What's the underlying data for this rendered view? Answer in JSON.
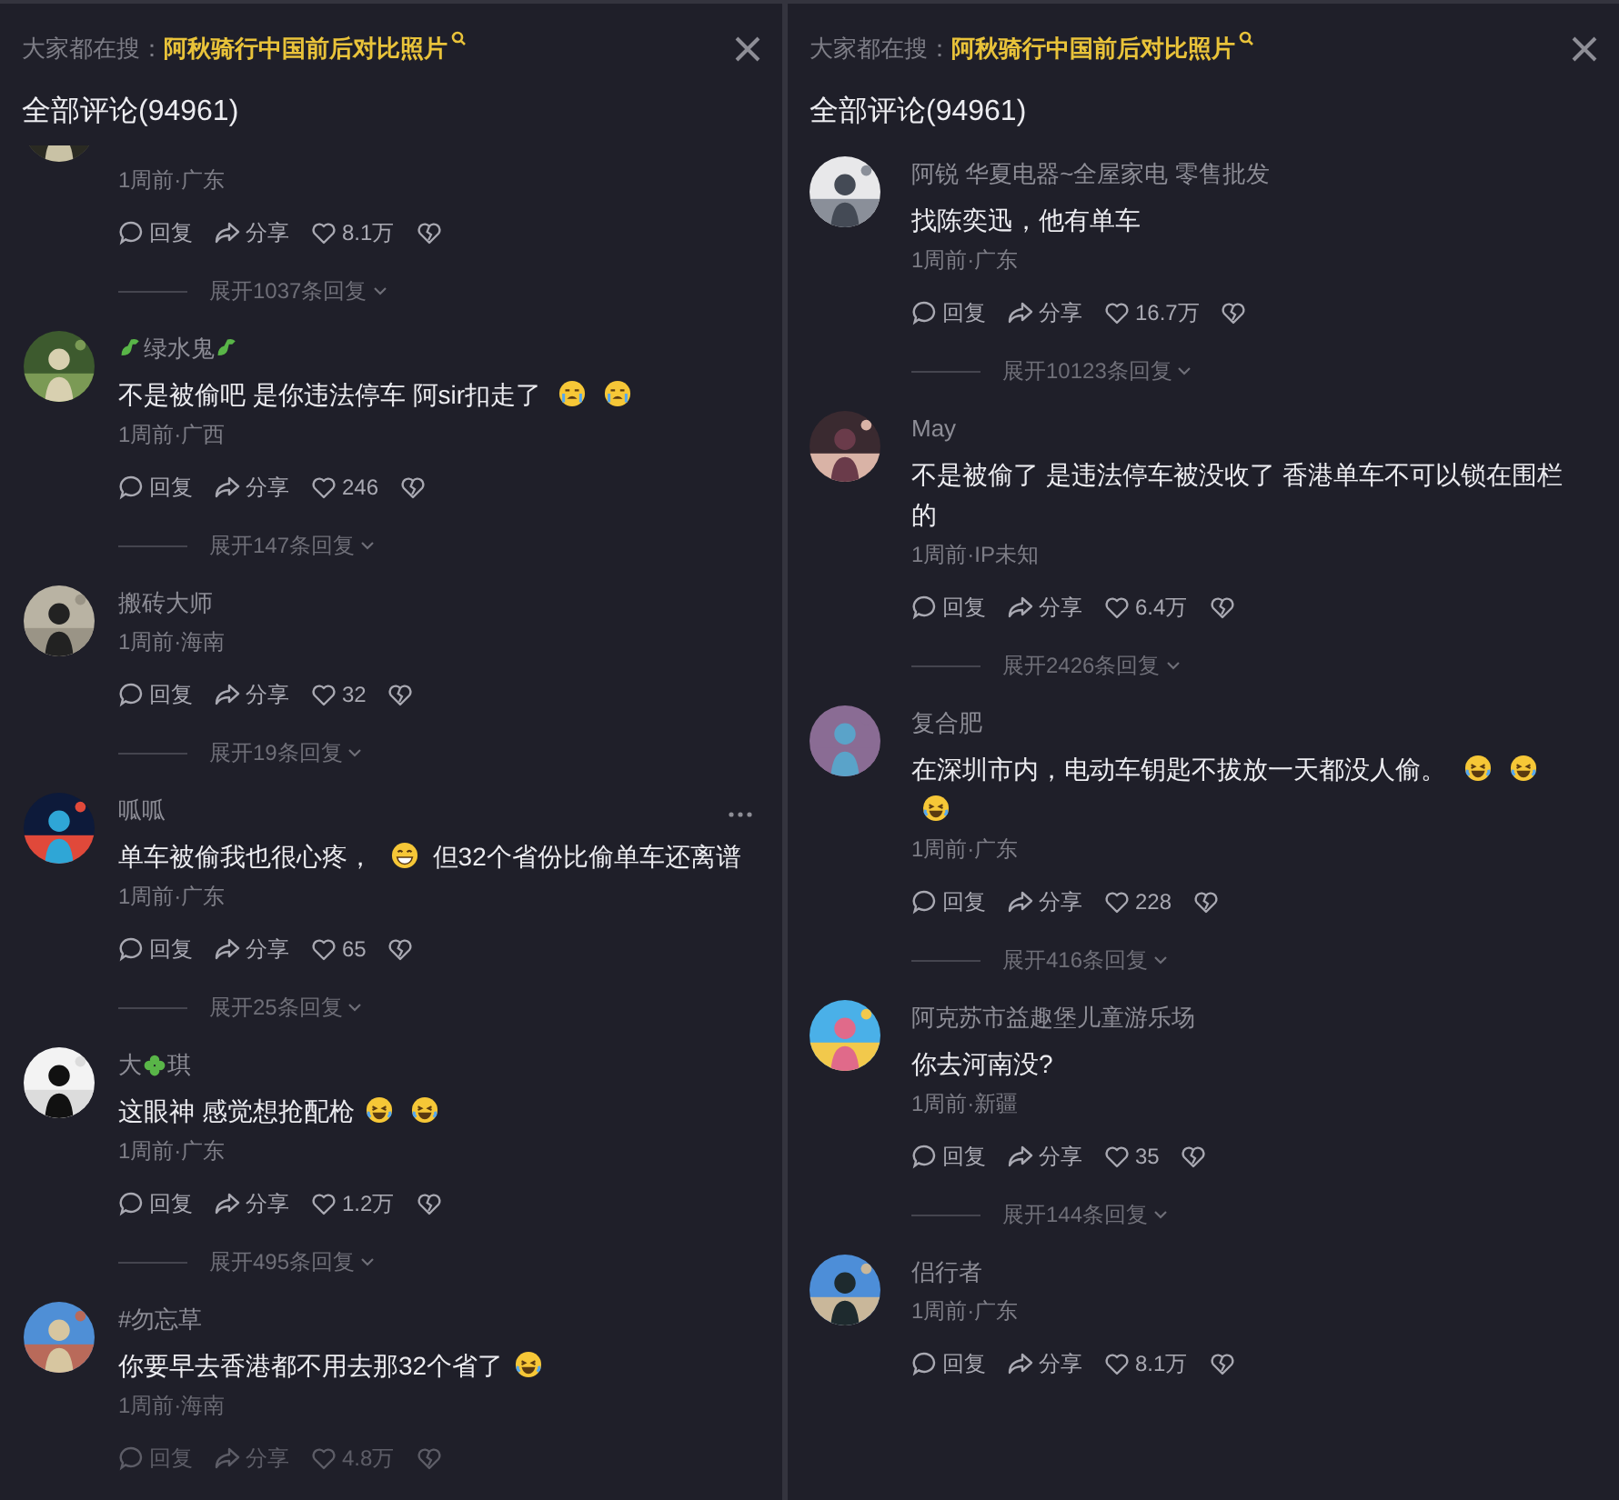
{
  "panels": [
    {
      "hot_search": {
        "label": "大家都在搜：",
        "query": "阿秋骑行中国前后对比照片"
      },
      "title": "全部评论(94961)",
      "comments": [
        {
          "meta": "1周前·广东",
          "reply": "回复",
          "share": "分享",
          "likes": "8.1万",
          "expand": "展开1037条回复",
          "menu_shown": false,
          "faded": false
        },
        {
          "name": [
            {
              "kind": "dino"
            },
            {
              "kind": "text",
              "text": "绿水鬼"
            },
            {
              "kind": "dino"
            }
          ],
          "text": [
            {
              "kind": "text",
              "text": "不是被偷吧 是你违法停车 阿sir扣走了 "
            },
            {
              "kind": "cry"
            },
            {
              "kind": "cry"
            }
          ],
          "meta": "1周前·广西",
          "reply": "回复",
          "share": "分享",
          "likes": "246",
          "expand": "展开147条回复",
          "menu_shown": false,
          "faded": false
        },
        {
          "name": [
            {
              "kind": "text",
              "text": "搬砖大师"
            }
          ],
          "meta": "1周前·海南",
          "reply": "回复",
          "share": "分享",
          "likes": "32",
          "expand": "展开19条回复",
          "menu_shown": false,
          "faded": false
        },
        {
          "name": [
            {
              "kind": "text",
              "text": "呱呱"
            }
          ],
          "text": [
            {
              "kind": "text",
              "text": "单车被偷我也很心疼， "
            },
            {
              "kind": "grin"
            },
            {
              "kind": "text",
              "text": " 但32个省份比偷单车还离谱"
            }
          ],
          "meta": "1周前·广东",
          "reply": "回复",
          "share": "分享",
          "likes": "65",
          "expand": "展开25条回复",
          "menu_shown": true,
          "faded": false
        },
        {
          "name": [
            {
              "kind": "text",
              "text": "大"
            },
            {
              "kind": "leaf"
            },
            {
              "kind": "text",
              "text": "琪"
            }
          ],
          "text": [
            {
              "kind": "text",
              "text": "这眼神 感觉想抢配枪"
            },
            {
              "kind": "laugh"
            },
            {
              "kind": "laugh"
            }
          ],
          "meta": "1周前·广东",
          "reply": "回复",
          "share": "分享",
          "likes": "1.2万",
          "expand": "展开495条回复",
          "menu_shown": false,
          "faded": false
        },
        {
          "name": [
            {
              "kind": "text",
              "text": "#勿忘草"
            }
          ],
          "text": [
            {
              "kind": "text",
              "text": "你要早去香港都不用去那32个省了"
            },
            {
              "kind": "laugh"
            }
          ],
          "meta": "1周前·海南",
          "reply": "回复",
          "share": "分享",
          "likes": "4.8万",
          "menu_shown": false,
          "faded": true
        }
      ]
    },
    {
      "hot_search": {
        "label": "大家都在搜：",
        "query": "阿秋骑行中国前后对比照片"
      },
      "title": "全部评论(94961)",
      "comments": [
        {
          "name": [
            {
              "kind": "text",
              "text": "阿锐 华夏电器~全屋家电 零售批发"
            }
          ],
          "text": [
            {
              "kind": "text",
              "text": "找陈奕迅，他有单车"
            }
          ],
          "meta": "1周前·广东",
          "reply": "回复",
          "share": "分享",
          "likes": "16.7万",
          "expand": "展开10123条回复",
          "menu_shown": false,
          "faded": false
        },
        {
          "name": [
            {
              "kind": "text",
              "text": "May"
            }
          ],
          "text": [
            {
              "kind": "text",
              "text": "不是被偷了 是违法停车被没收了 香港单车不可以锁在围栏的"
            }
          ],
          "meta": "1周前·IP未知",
          "reply": "回复",
          "share": "分享",
          "likes": "6.4万",
          "expand": "展开2426条回复",
          "menu_shown": false,
          "faded": false
        },
        {
          "name": [
            {
              "kind": "text",
              "text": "复合肥"
            }
          ],
          "text": [
            {
              "kind": "text",
              "text": "在深圳市内，电动车钥匙不拔放一天都没人偷。 "
            },
            {
              "kind": "laugh"
            },
            {
              "kind": "laugh"
            },
            {
              "kind": "laugh"
            }
          ],
          "meta": "1周前·广东",
          "reply": "回复",
          "share": "分享",
          "likes": "228",
          "expand": "展开416条回复",
          "menu_shown": false,
          "faded": false
        },
        {
          "name": [
            {
              "kind": "text",
              "text": "阿克苏市益趣堡儿童游乐场"
            }
          ],
          "text": [
            {
              "kind": "text",
              "text": "你去河南没?"
            }
          ],
          "meta": "1周前·新疆",
          "reply": "回复",
          "share": "分享",
          "likes": "35",
          "expand": "展开144条回复",
          "menu_shown": false,
          "faded": false
        },
        {
          "name": [
            {
              "kind": "text",
              "text": "侣行者"
            }
          ],
          "meta": "1周前·广东",
          "reply": "回复",
          "share": "分享",
          "likes": "8.1万",
          "menu_shown": false,
          "faded": false
        }
      ]
    }
  ]
}
